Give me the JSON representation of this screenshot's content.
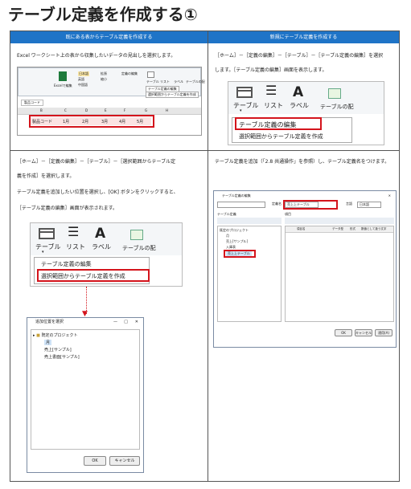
{
  "page_title": "テーブル定義を作成する①",
  "headers": {
    "left": "既にある表からテーブル定義を作成する",
    "right": "新規にテーブル定義を作成する"
  },
  "cells": {
    "top_left_text": "Excel ワークシート上の表から収集したいデータの見出しを選択します。",
    "top_right_text_1": "［ホーム］－［定義の編集］－［テーブル］－［テーブル定義の編集］を選択",
    "top_right_text_2": "します。［テーブル定義の編集］画面を表示します。",
    "bottom_left_text_1": "［ホーム］－［定義の編集］－［テーブル］－［選択範囲からテーブル定",
    "bottom_left_text_2": "義を作成］を選択します。",
    "bottom_left_text_3": "テーブル定義を追加したい位置を選択し、[OK] ボタンをクリックすると、",
    "bottom_left_text_4": "［テーブル定義の編集］画面が表示されます。",
    "bottom_right_text": "テーブル定義を追加（「2.8 共通操作」を参照）し、テーブル定義名をつけます。"
  },
  "excel_shot": {
    "cell_ref": "製品コード",
    "ribbon_labels": [
      "Excelで編集",
      "日本語",
      "英語",
      "中国語",
      "拡張",
      "縮小",
      "定義の編集",
      "テーブル",
      "リスト",
      "ラベル",
      "テーブルの配"
    ],
    "menu_items": [
      "テーブル定義の編集",
      "選択範囲からテーブル定義を作成"
    ],
    "columns": [
      "B",
      "C",
      "D",
      "E",
      "F",
      "G",
      "H"
    ],
    "selected_row": [
      "製品コード",
      "1月",
      "2月",
      "3月",
      "4月",
      "5月"
    ]
  },
  "ribbon_big": {
    "table_label": "テーブル",
    "list_label": "リスト",
    "label_label": "ラベル",
    "label_icon": "A",
    "layout_label": "テーブルの配",
    "menu_edit": "テーブル定義の編集",
    "menu_create": "選択範囲からテーブル定義を作成"
  },
  "dialog_add": {
    "title": "追加位置を選択",
    "tree_root": "既定のプロジェクト",
    "tree_selected": "月",
    "tree_item_1": "売上[サンプル]",
    "tree_item_2": "売上書面[サンプル]",
    "ok": "OK",
    "cancel": "キャンセル"
  },
  "dialog_edit": {
    "title": "テーブル定義の編集",
    "name_label": "定義名",
    "name_value": "売上上テーブル",
    "lang_label": "言語",
    "lang_value": "日本語",
    "tree_header": "テーブル定義",
    "field_header": "項目",
    "tree_root": "既定のプロジェクト",
    "tree_items": [
      "月",
      "売上[サンプル]",
      "入庫表"
    ],
    "tree_new": "売上上テーブル",
    "col_headers": [
      "項目名",
      "データ型",
      "形式",
      "数値として扱う文字"
    ],
    "ok": "OK",
    "cancel": "キャンセル",
    "apply": "適用(A)"
  },
  "colors": {
    "header_bg": "#1f74c7",
    "highlight": "#d4141c"
  }
}
